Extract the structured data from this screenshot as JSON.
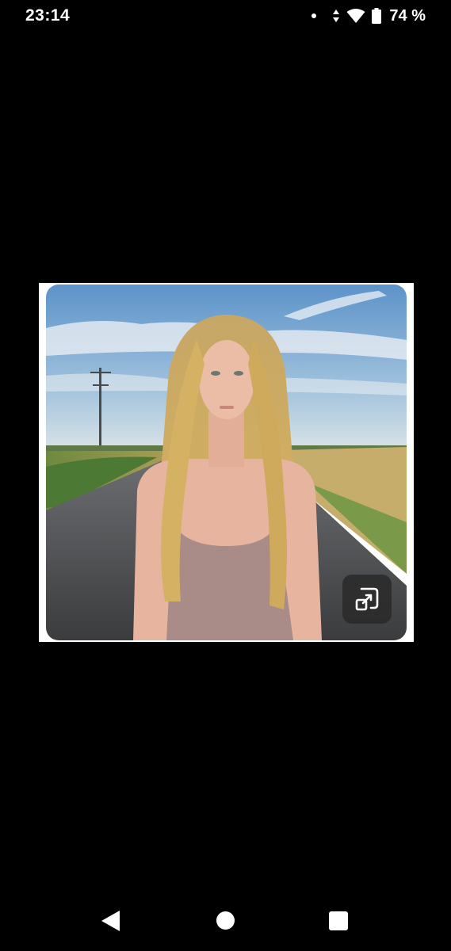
{
  "status_bar": {
    "time": "23:14",
    "battery_percent": "74 %",
    "icons": [
      "notification-dot-icon",
      "data-arrows-icon",
      "wifi-icon",
      "battery-icon"
    ]
  },
  "viewer": {
    "expand_icon": "expand-icon"
  },
  "nav_bar": {
    "icons": [
      "back-icon",
      "home-icon",
      "recents-icon"
    ]
  },
  "colors": {
    "background": "#000000",
    "frame": "#ffffff",
    "button_bg": "#282828"
  }
}
